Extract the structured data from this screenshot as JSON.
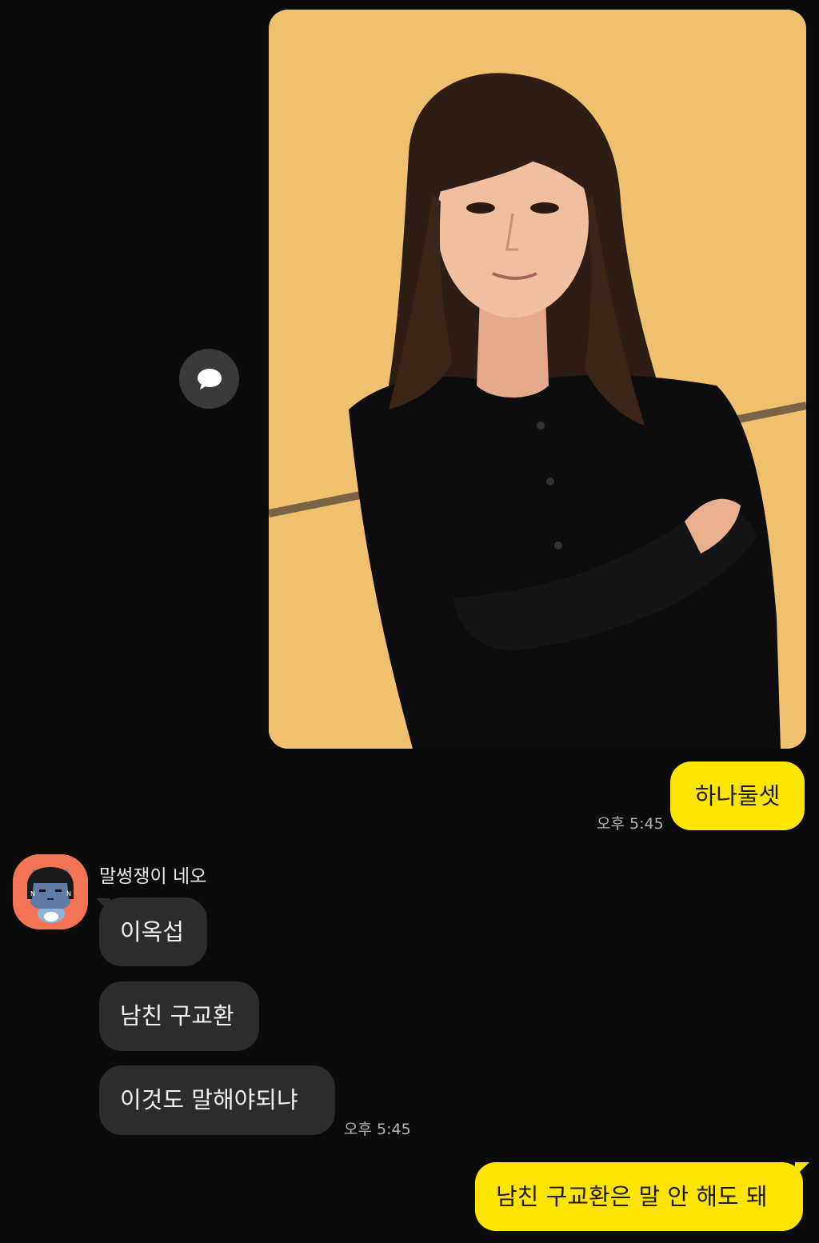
{
  "messages": {
    "sent_1": {
      "text": "하나둘셋",
      "time": "오후 5:45"
    },
    "sender_name": "말썽쟁이 네오",
    "received": [
      {
        "text": "이옥섭"
      },
      {
        "text": "남친 구교환"
      },
      {
        "text": "이것도 말해야되냐"
      }
    ],
    "received_time": "오후 5:45",
    "sent_2": {
      "text": "남친 구교환은 말 안 해도 돼"
    }
  },
  "icons": {
    "share": "speech-bubble-icon",
    "avatar": "neo-character-avatar"
  },
  "colors": {
    "background": "#0b0b0b",
    "my_bubble": "#fee500",
    "their_bubble": "#2c2c2c",
    "timestamp": "#b4b4b4",
    "avatar_bg": "#f27455"
  }
}
